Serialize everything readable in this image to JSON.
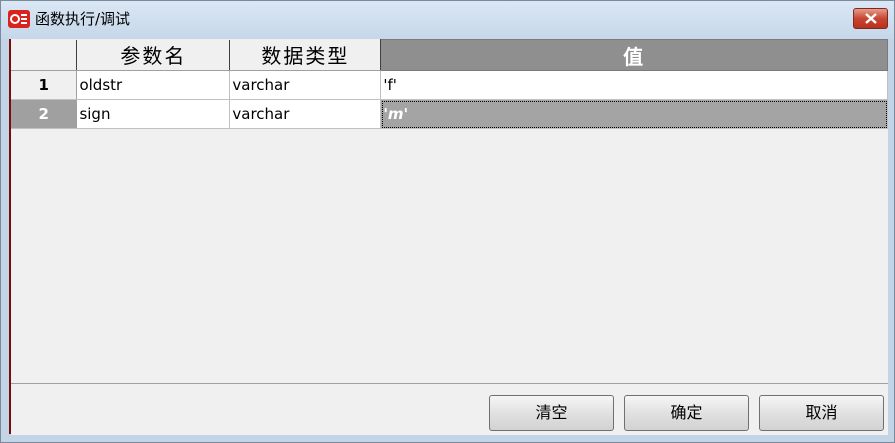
{
  "window": {
    "title": "函数执行/调试"
  },
  "grid": {
    "columns": [
      "",
      "参数名",
      "数据类型",
      "值"
    ],
    "rows": [
      {
        "num": "1",
        "name": "oldstr",
        "type": "varchar",
        "value": "'f'"
      },
      {
        "num": "2",
        "name": "sign",
        "type": "varchar",
        "value": "'m'"
      }
    ],
    "selected_row": 2
  },
  "buttons": {
    "clear": "清空",
    "ok": "确定",
    "cancel": "取消"
  },
  "colors": {
    "title_bg": "#c5d7ea",
    "header_selected_bg": "#8f8f8f",
    "close_button": "#c84631"
  }
}
